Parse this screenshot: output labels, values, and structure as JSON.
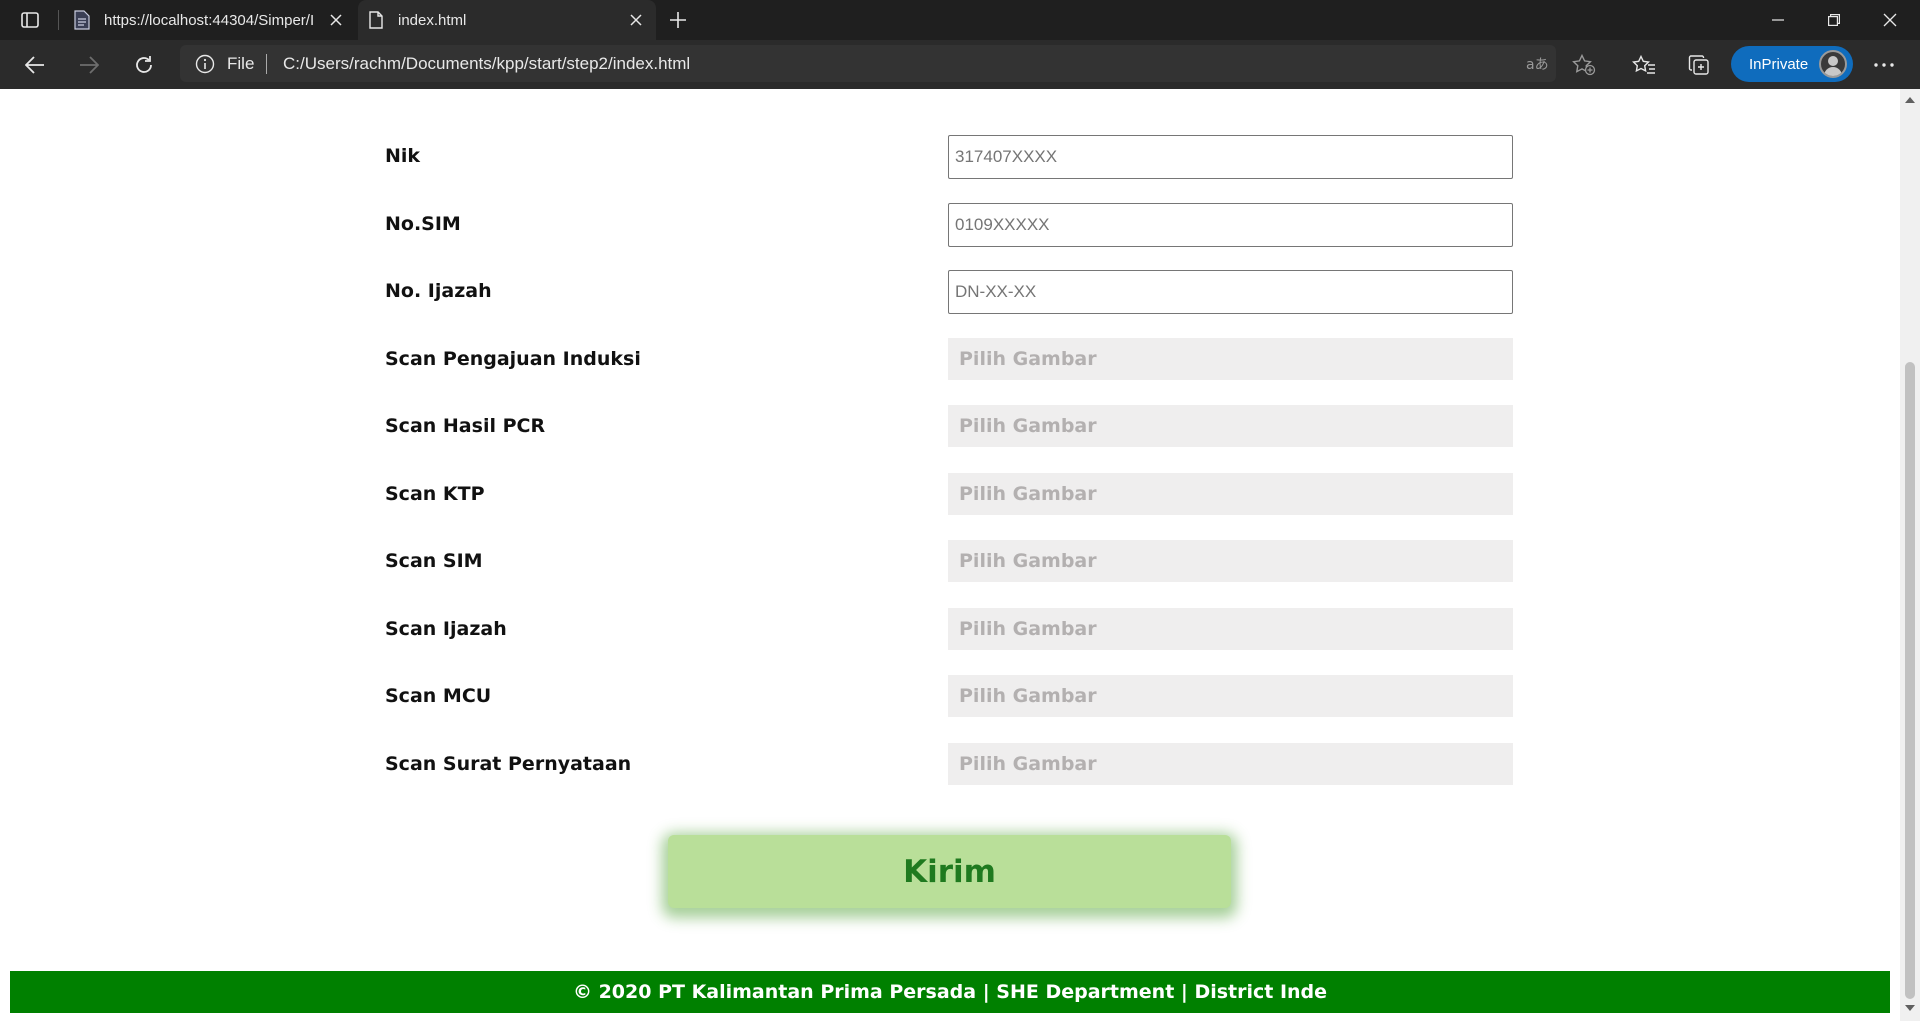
{
  "browser": {
    "tabs": [
      {
        "title": "https://localhost:44304/Simper/I",
        "active": false
      },
      {
        "title": "index.html",
        "active": true
      }
    ],
    "address": {
      "scheme_label": "File",
      "url": "C:/Users/rachm/Documents/kpp/start/step2/index.html"
    },
    "profile_label": "InPrivate"
  },
  "form": {
    "fields": [
      {
        "label": "Nik",
        "placeholder": "317407XXXX"
      },
      {
        "label": "No.SIM",
        "placeholder": "0109XXXXX"
      },
      {
        "label": "No. Ijazah",
        "placeholder": "DN-XX-XX"
      }
    ],
    "uploads": [
      {
        "label": "Scan Pengajuan Induksi",
        "button_text": "Pilih Gambar"
      },
      {
        "label": "Scan Hasil PCR",
        "button_text": "Pilih Gambar"
      },
      {
        "label": "Scan KTP",
        "button_text": "Pilih Gambar"
      },
      {
        "label": "Scan SIM",
        "button_text": "Pilih Gambar"
      },
      {
        "label": "Scan Ijazah",
        "button_text": "Pilih Gambar"
      },
      {
        "label": "Scan MCU",
        "button_text": "Pilih Gambar"
      },
      {
        "label": "Scan Surat Pernyataan",
        "button_text": "Pilih Gambar"
      }
    ],
    "submit_label": "Kirim"
  },
  "footer": {
    "text": "© 2020 PT Kalimantan Prima Persada | SHE Department | District Inde"
  },
  "colors": {
    "footer_bg": "#008000",
    "submit_bg": "#b9df99",
    "submit_text": "#1f7a1f",
    "upload_bg": "#efeeee",
    "inprivate_badge": "#0f6cbd"
  },
  "icons": {
    "tab_actions": "tab-actions-icon",
    "back": "back-arrow-icon",
    "forward": "forward-arrow-icon",
    "refresh": "refresh-icon",
    "info": "info-icon",
    "read_aloud": "read-aloud-icon",
    "add_favorite": "add-favorite-icon",
    "favorites": "favorites-icon",
    "collections": "collections-icon",
    "more": "more-icon"
  }
}
